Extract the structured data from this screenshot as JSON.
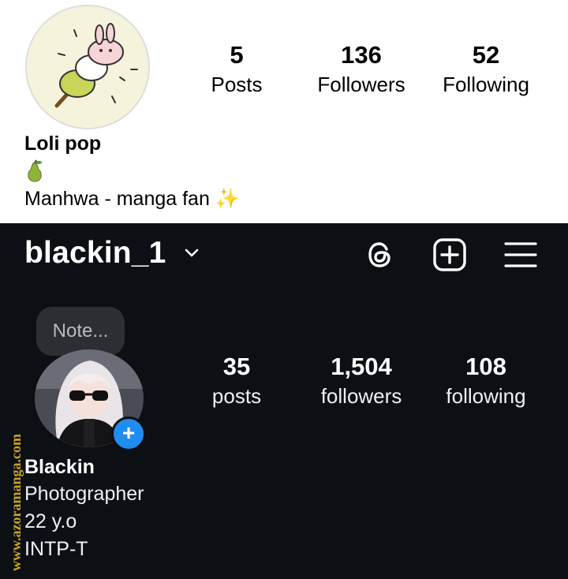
{
  "light_profile": {
    "stats": [
      {
        "value": "5",
        "label": "Posts"
      },
      {
        "value": "136",
        "label": "Followers"
      },
      {
        "value": "52",
        "label": "Following"
      }
    ],
    "display_name": "Loli pop",
    "emoji_line": "🍐",
    "bio": "Manhwa - manga fan ✨"
  },
  "dark_profile": {
    "username": "blackin_1",
    "note_placeholder": "Note...",
    "stats": [
      {
        "value": "35",
        "label": "posts"
      },
      {
        "value": "1,504",
        "label": "followers"
      },
      {
        "value": "108",
        "label": "following"
      }
    ],
    "display_name": "Blackin",
    "bio_lines": [
      "Photographer",
      "22 y.o",
      "INTP-T"
    ],
    "icons": [
      "dropdown-chevron-icon",
      "threads-icon",
      "create-post-icon",
      "menu-icon"
    ],
    "add_badge": "+"
  },
  "watermark": "www.azoramanga.com",
  "colors": {
    "dark_background": "#0c0f14",
    "light_background": "#ffffff",
    "accent_blue": "#1f8cf0",
    "watermark_color": "#c9a227"
  }
}
